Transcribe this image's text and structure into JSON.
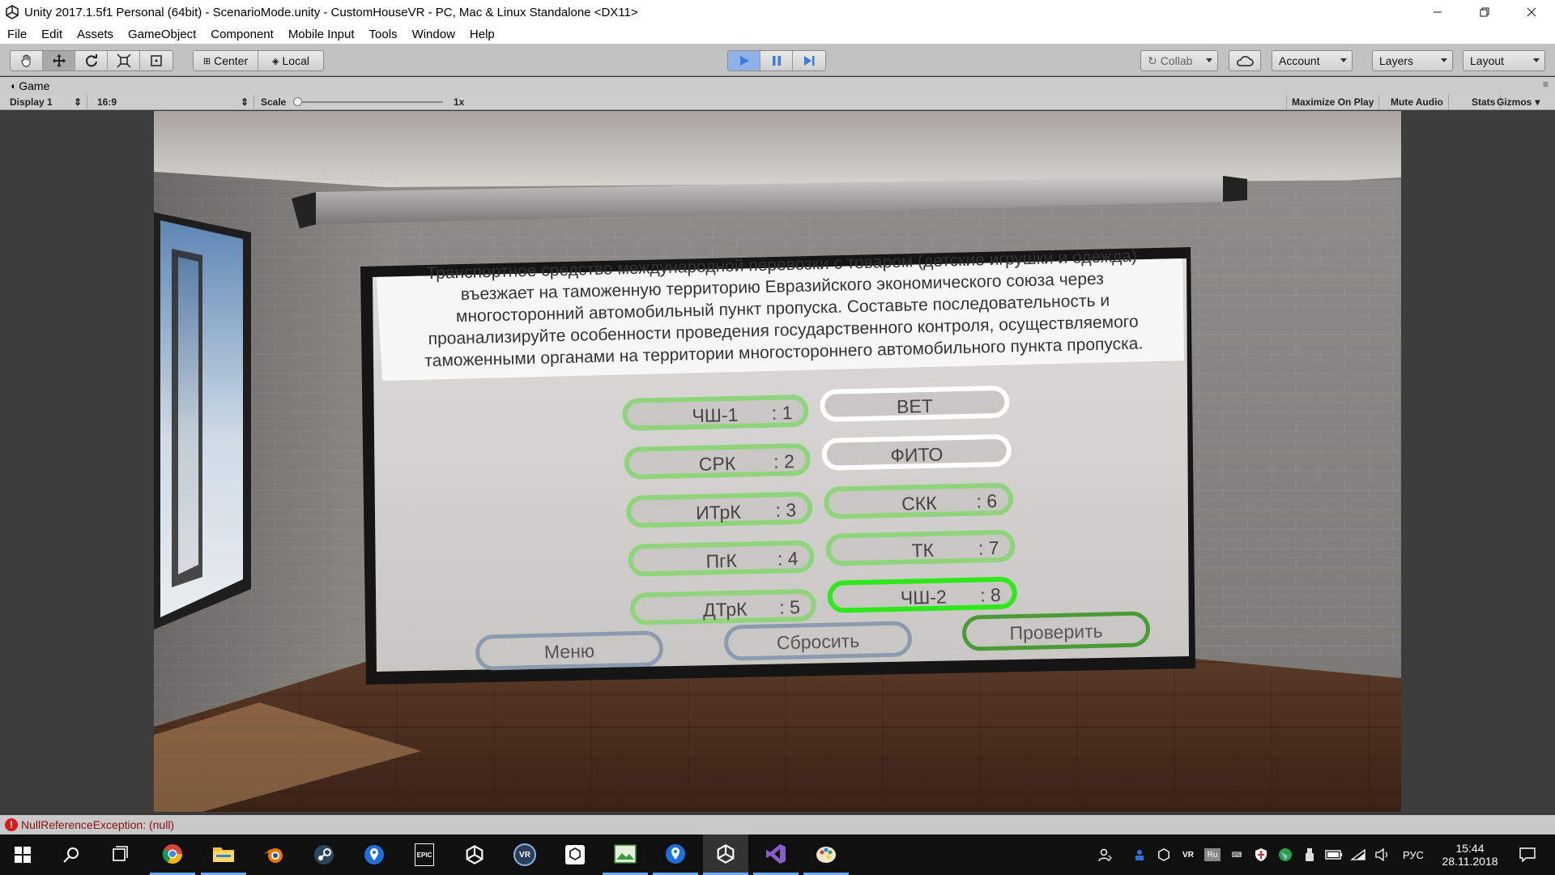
{
  "window": {
    "title": "Unity 2017.1.5f1 Personal (64bit) - ScenarioMode.unity - CustomHouseVR - PC, Mac & Linux Standalone <DX11>"
  },
  "menu": [
    "File",
    "Edit",
    "Assets",
    "GameObject",
    "Component",
    "Mobile Input",
    "Tools",
    "Window",
    "Help"
  ],
  "toolbar": {
    "pivot": "Center",
    "space": "Local",
    "collab": "Collab",
    "account": "Account",
    "layers": "Layers",
    "layout": "Layout",
    "colors": {
      "play_active": "#3b7be6"
    }
  },
  "game_tab": {
    "label": "Game",
    "display": "Display 1",
    "aspect": "16:9",
    "scale_label": "Scale",
    "scale_value": "1x",
    "scale_fraction": 0.0,
    "maximize": "Maximize On Play",
    "mute": "Mute Audio",
    "stats": "Stats",
    "gizmos": "Gizmos"
  },
  "scene": {
    "question": "Транспортное средство международной перевозки с товаром (детские игрушки и одежда) въезжает на таможенную территорию Евразийского экономического союза через многосторонний автомобильный пункт пропуска. Составьте последовательность и проанализируйте особенности проведения государственного контроля, осуществляемого таможенными органами на территории многостороннего автомобильного пункта пропуска.",
    "left_options": [
      {
        "label": "ЧШ-1",
        "num": ": 1"
      },
      {
        "label": "СРК",
        "num": ": 2"
      },
      {
        "label": "ИТрК",
        "num": ": 3"
      },
      {
        "label": "ПгК",
        "num": ": 4"
      },
      {
        "label": "ДТрК",
        "num": ": 5"
      }
    ],
    "right_options": [
      {
        "label": "ВЕТ",
        "num": ""
      },
      {
        "label": "ФИТО",
        "num": ""
      },
      {
        "label": "СКК",
        "num": ": 6"
      },
      {
        "label": "ТК",
        "num": ": 7"
      },
      {
        "label": "ЧШ-2",
        "num": ": 8"
      }
    ],
    "buttons": {
      "menu": "Меню",
      "reset": "Сбросить",
      "check": "Проверить"
    },
    "colors": {
      "selected": "#8fd47c",
      "unselected": "#ffffff",
      "highlight": "#2ee81a",
      "nav": "#8a9bb0",
      "check": "#4a9a36"
    }
  },
  "status": {
    "message": "NullReferenceException: (null)"
  },
  "taskbar": {
    "icons": [
      "start-icon",
      "search-icon",
      "task-view-icon",
      "chrome-icon",
      "file-explorer-icon",
      "blender-icon",
      "steam-icon",
      "maps-pin-icon",
      "epic-games-icon",
      "unity-icon",
      "vr-icon",
      "unity-hub-icon",
      "image-editor-icon",
      "maps-pin-icon-2",
      "unity-active-icon",
      "visual-studio-icon",
      "paint-icon"
    ],
    "epic_label": "EPIC",
    "lang": "РУС",
    "ru": "Ru",
    "vr": "VR",
    "time": "15:44",
    "date": "28.11.2018"
  }
}
